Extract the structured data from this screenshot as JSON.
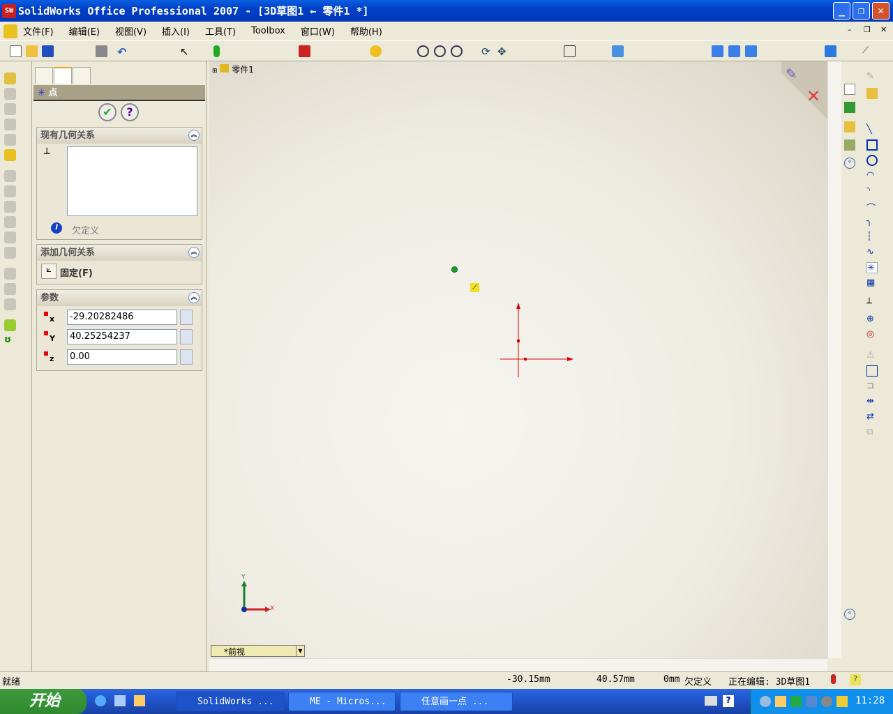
{
  "window": {
    "title": "SolidWorks Office Professional 2007 - [3D草图1 ← 零件1 *]",
    "logo": "SW"
  },
  "menu": [
    "文件(F)",
    "编辑(E)",
    "视图(V)",
    "插入(I)",
    "工具(T)",
    "Toolbox",
    "窗口(W)",
    "帮助(H)"
  ],
  "panel": {
    "title": "点",
    "section_existing": {
      "title": "现有几何关系",
      "status": "欠定义"
    },
    "section_add": {
      "title": "添加几何关系",
      "fix_label": "固定(F)"
    },
    "section_params": {
      "title": "参数",
      "x_label": "x",
      "x_value": "-29.20282486",
      "y_label": "Y",
      "y_value": "40.25254237",
      "z_label": "z",
      "z_value": "0.00"
    }
  },
  "tree": {
    "root": "零件1"
  },
  "view": {
    "orientation": "*前视",
    "axis_x": "X",
    "axis_y": "Y"
  },
  "status": {
    "ready": "就绪",
    "x": "-30.15mm",
    "y": "40.57mm",
    "z": "0mm",
    "state": "欠定义",
    "editing": "正在编辑: 3D草图1"
  },
  "taskbar": {
    "start": "开始",
    "tasks": [
      "SolidWorks ...",
      "ME - Micros...",
      "任意画一点 ..."
    ],
    "time": "11:28"
  },
  "colors": {
    "sketch_red": "#e00000",
    "point_green": "#1aa01a"
  }
}
